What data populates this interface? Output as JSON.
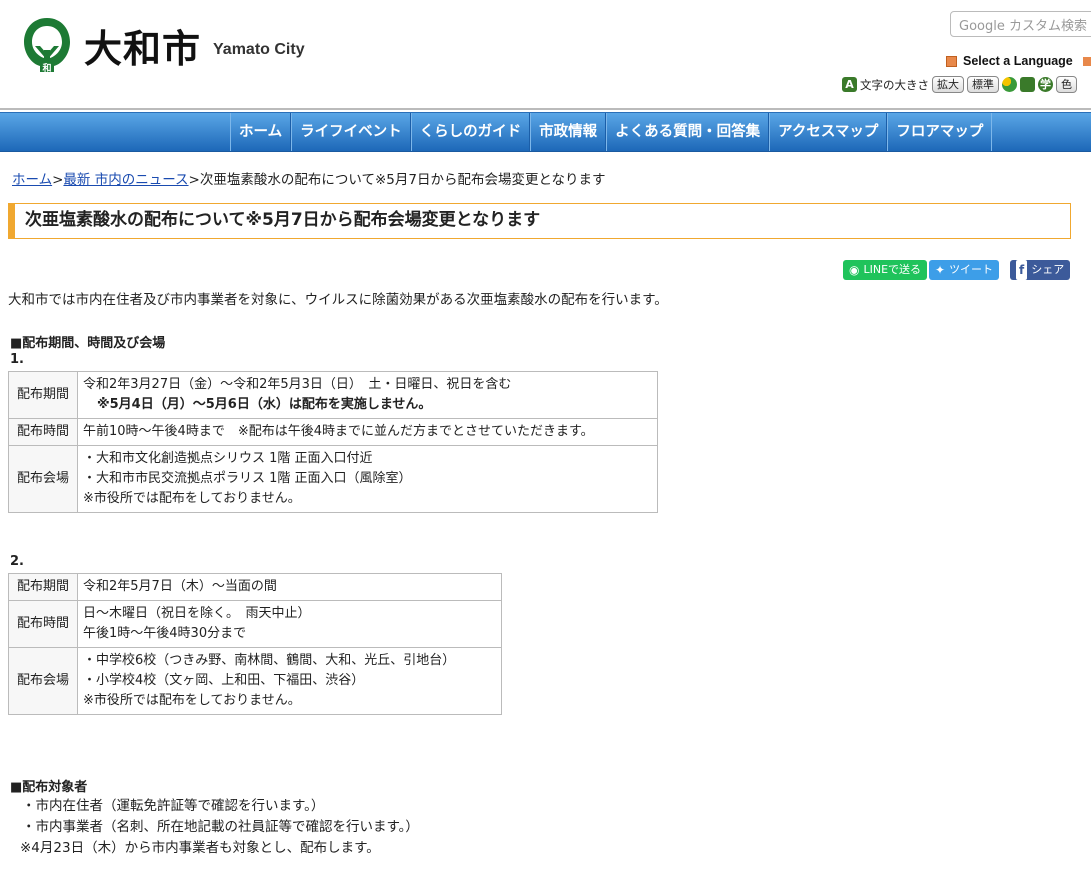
{
  "header": {
    "logo_ja": "大和市",
    "logo_en": "Yamato City",
    "logo_badge": "和",
    "search_placeholder": "Google カスタム検索",
    "language_label": "Select a Language",
    "text_size_label": "文字の大きさ",
    "text_size_icon": "A",
    "enlarge_label": "拡大",
    "standard_label": "標準",
    "learn_label": "学",
    "color_label": "色"
  },
  "nav": {
    "items": [
      "ホーム",
      "ライフイベント",
      "くらしのガイド",
      "市政情報",
      "よくある質問・回答集",
      "アクセスマップ",
      "フロアマップ"
    ]
  },
  "breadcrumb": {
    "home": "ホーム",
    "sep": ">",
    "news": "最新 市内のニュース",
    "current": "次亜塩素酸水の配布について※5月7日から配布会場変更となります"
  },
  "page_title": "次亜塩素酸水の配布について※5月7日から配布会場変更となります",
  "share": {
    "line": "LINEで送る",
    "tweet": "ツイート",
    "facebook": "シェア"
  },
  "intro": "大和市では市内在住者及び市内事業者を対象に、ウイルスに除菌効果がある次亜塩素酸水の配布を行います。",
  "section1": {
    "heading": "■配布期間、時間及び会場",
    "number1": "1.",
    "table1": {
      "period_label": "配布期間",
      "period_line1": "令和2年3月27日（金）～令和2年5月3日（日）　土・日曜日、祝日を含む",
      "period_line2": "※5月4日（月）～5月6日（水）は配布を実施しません。",
      "time_label": "配布時間",
      "time_line1": "午前10時～午後4時まで　※配布は午後4時までに並んだ方までとさせていただきます。",
      "venue_label": "配布会場",
      "venue_line1": "・大和市文化創造拠点シリウス 1階 正面入口付近",
      "venue_line2": "・大和市市民交流拠点ポラリス 1階 正面入口（風除室）",
      "venue_line3": "※市役所では配布をしておりません。"
    },
    "number2": "2.",
    "table2": {
      "period_label": "配布期間",
      "period_line1": "令和2年5月7日（木）～当面の間",
      "time_label": "配布時間",
      "time_line1": "日～木曜日（祝日を除く。　雨天中止）",
      "time_line2": "午後1時～午後4時30分まで",
      "venue_label": "配布会場",
      "venue_line1": "・中学校6校（つきみ野、南林間、鶴間、大和、光丘、引地台）",
      "venue_line2": "・小学校4校（文ヶ岡、上和田、下福田、渋谷）",
      "venue_line3": "※市役所では配布をしておりません。"
    }
  },
  "section2": {
    "heading": "■配布対象者",
    "line1": "・市内在住者（運転免許証等で確認を行います。）",
    "line2": "・市内事業者（名刺、所在地記載の社員証等で確認を行います。）",
    "line3": "※4月23日（木）から市内事業者も対象とし、配布します。"
  },
  "colors": {
    "nav_blue": "#2a78c8",
    "title_accent": "#f0a830",
    "logo_green": "#1d7a34",
    "link": "#1a4bb0"
  }
}
